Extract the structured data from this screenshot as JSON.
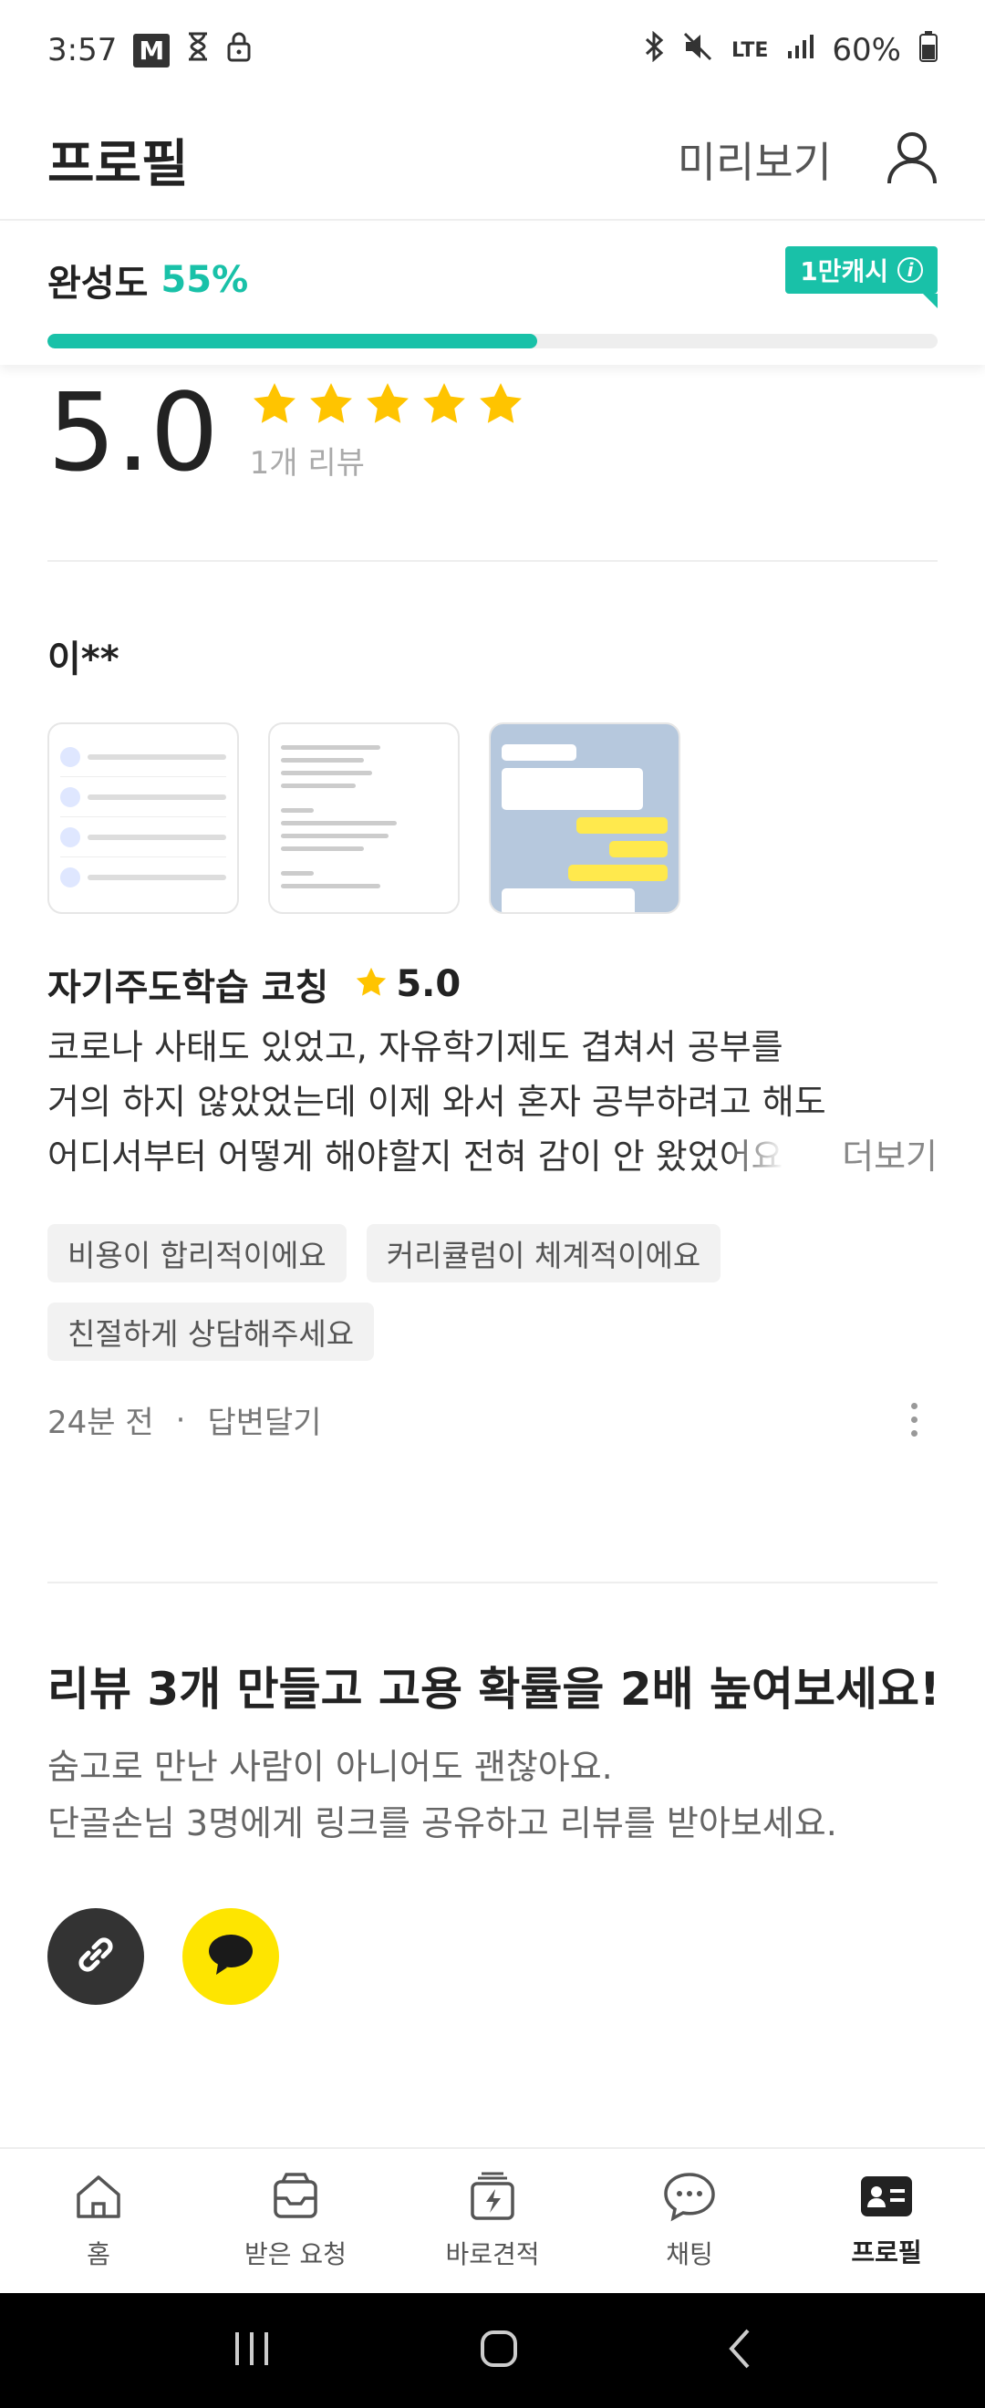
{
  "status_bar": {
    "time": "3:57",
    "m_badge": "M",
    "network": "LTE",
    "battery": "60%"
  },
  "header": {
    "title": "프로필",
    "preview_label": "미리보기"
  },
  "completion": {
    "label": "완성도",
    "percent_text": "55%",
    "progress_fraction": 0.55,
    "badge_label": "1만캐시",
    "badge_info": "i"
  },
  "rating_summary": {
    "score": "5.0",
    "review_count": "1개 리뷰",
    "stars": 5
  },
  "review": {
    "reviewer": "이**",
    "service": "자기주도학습 코칭",
    "service_score": "5.0",
    "body_lines": [
      "코로나 사태도 있었고, 자유학기제도 겹쳐서 공부를",
      "거의 하지 않았었는데 이제 와서 혼자 공부하려고 해도",
      "어디서부터 어떻게 해야할지 전혀 감이 안 왔었어요"
    ],
    "more_label": "더보기",
    "tags": [
      "비용이 합리적이에요",
      "커리큘럼이 체계적이에요",
      "친절하게 상담해주세요"
    ],
    "time_ago": "24분 전",
    "separator": "·",
    "reply_label": "답변달기"
  },
  "promo": {
    "title": "리뷰 3개 만들고 고용 확률을 2배 높여보세요!",
    "desc_line1": "숨고로 만난 사람이 아니어도 괜찮아요.",
    "desc_line2": "단골손님 3명에게 링크를 공유하고 리뷰를 받아보세요."
  },
  "bottom_nav": [
    {
      "label": "홈",
      "icon": "home-icon"
    },
    {
      "label": "받은 요청",
      "icon": "inbox-icon"
    },
    {
      "label": "바로견적",
      "icon": "quick-quote-icon"
    },
    {
      "label": "채팅",
      "icon": "chat-icon"
    },
    {
      "label": "프로필",
      "icon": "profile-card-icon",
      "active": true
    }
  ],
  "colors": {
    "accent": "#19c1a8",
    "star": "#ffc400",
    "kakao": "#fee500"
  }
}
